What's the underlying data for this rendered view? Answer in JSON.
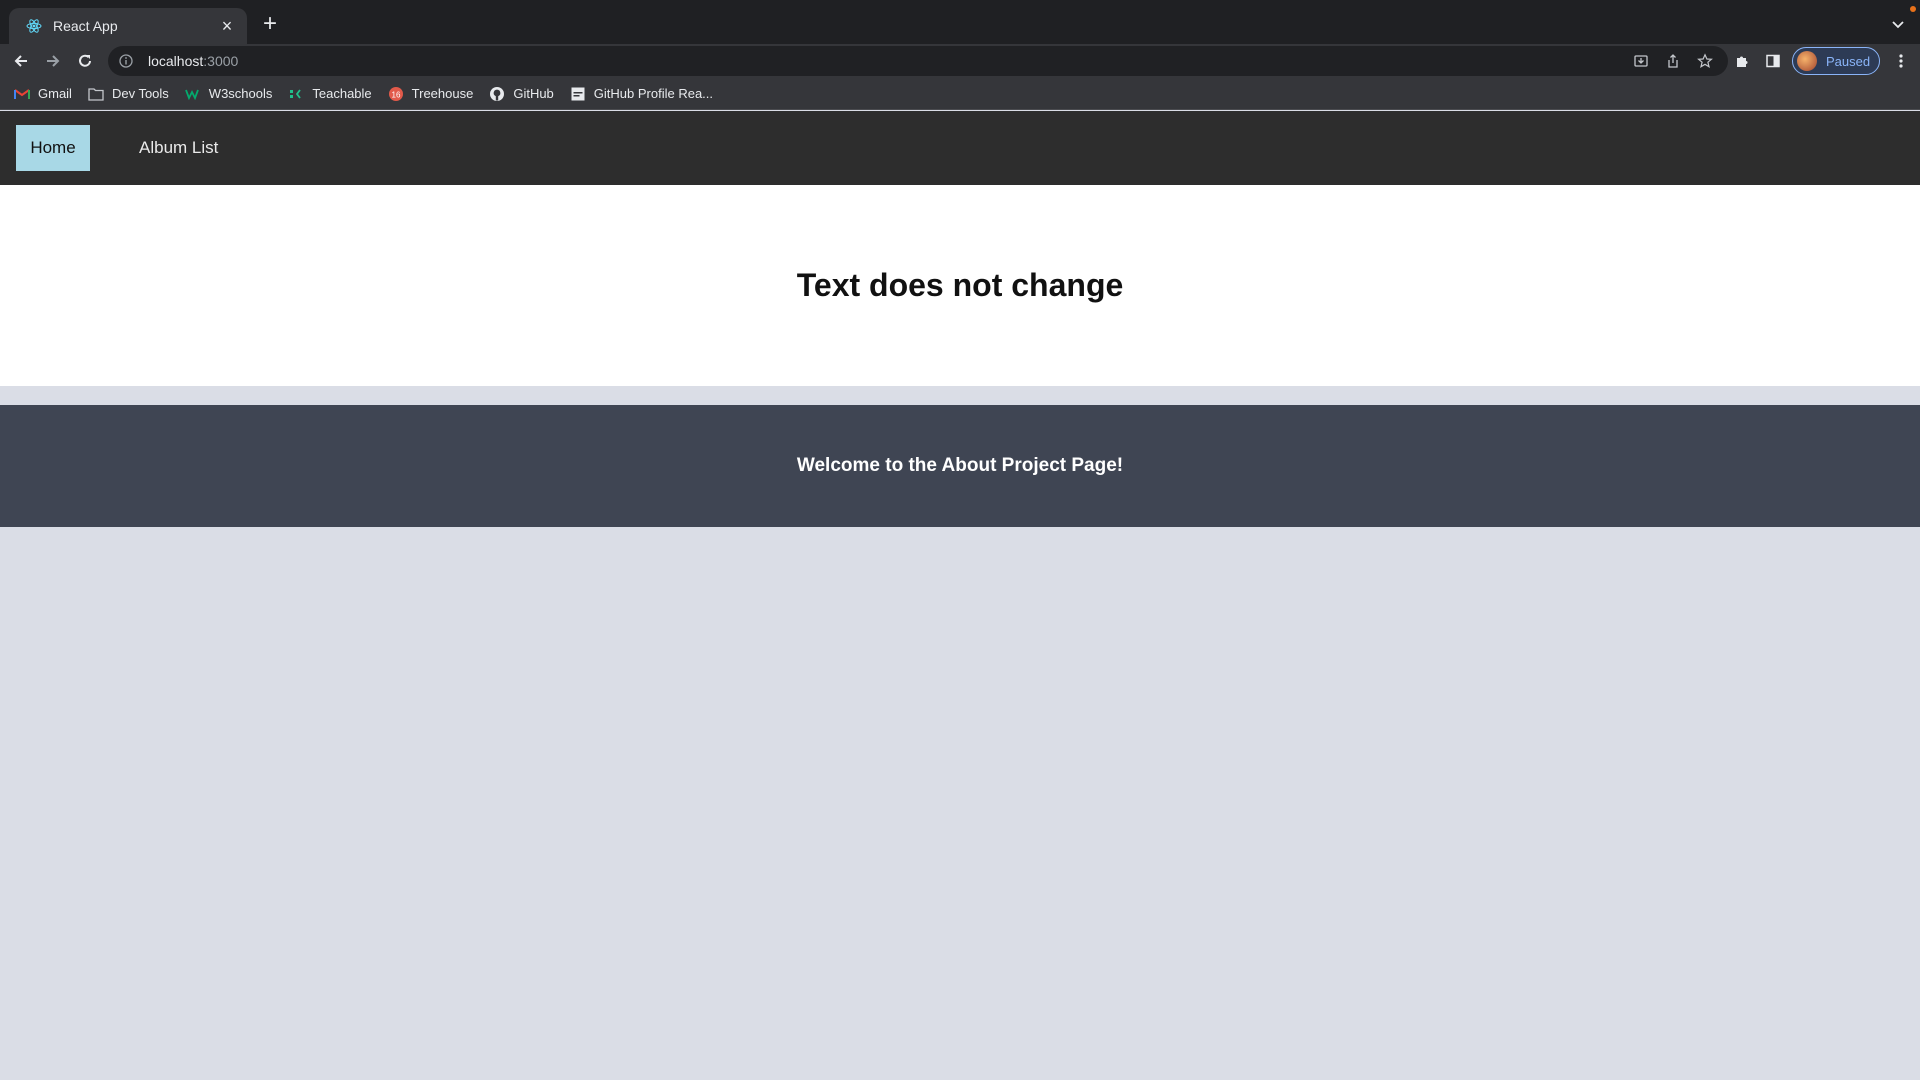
{
  "browser": {
    "tab": {
      "title": "React App",
      "close_glyph": "×"
    },
    "new_tab_glyph": "+",
    "address": {
      "host": "localhost",
      "port": ":3000"
    },
    "profile": {
      "label": "Paused"
    },
    "bookmarks": [
      {
        "label": "Gmail",
        "icon": "gmail-icon"
      },
      {
        "label": "Dev Tools",
        "icon": "folder-icon"
      },
      {
        "label": "W3schools",
        "icon": "w3schools-icon"
      },
      {
        "label": "Teachable",
        "icon": "teachable-icon"
      },
      {
        "label": "Treehouse",
        "icon": "treehouse-icon"
      },
      {
        "label": "GitHub",
        "icon": "github-icon"
      },
      {
        "label": "GitHub Profile Rea...",
        "icon": "page-icon"
      }
    ]
  },
  "app": {
    "nav": {
      "home_label": "Home",
      "albums_label": "Album List"
    },
    "hero": {
      "title": "Text does not change"
    },
    "about": {
      "text": "Welcome to the About Project Page!"
    }
  },
  "colors": {
    "nav_bg": "#2d2d2d",
    "home_active": "#a8d8e6",
    "about_band": "#3f4553",
    "page_bg": "#dadde6"
  }
}
